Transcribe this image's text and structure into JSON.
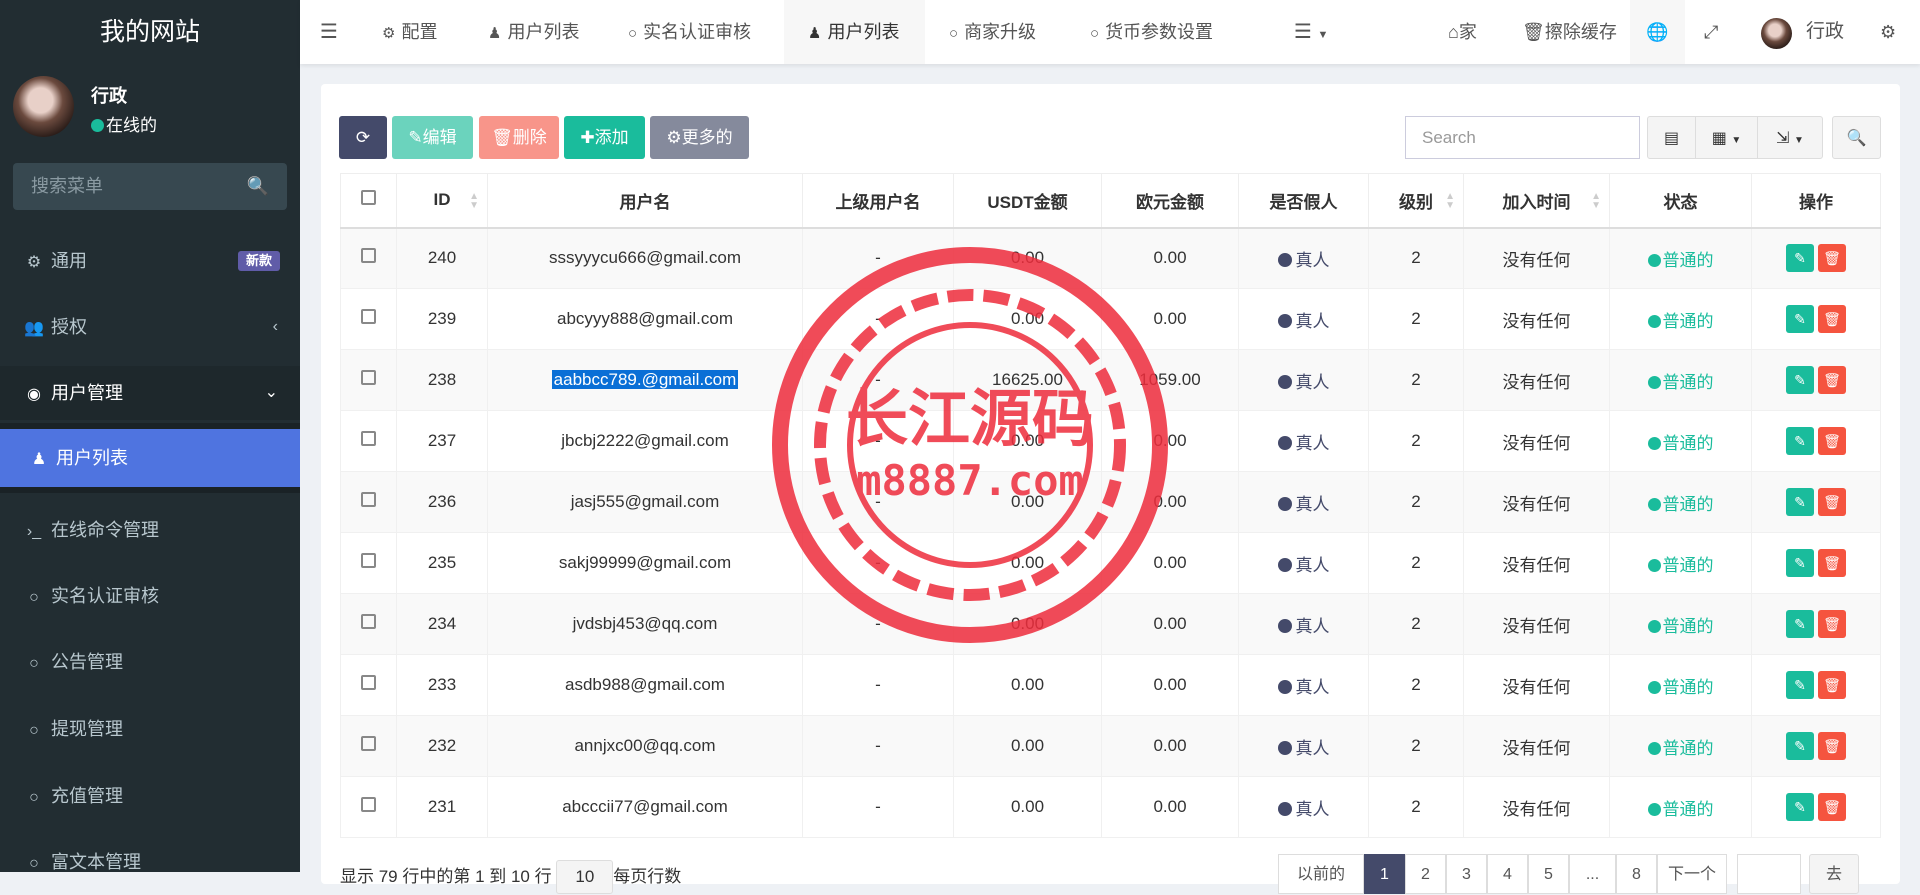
{
  "sidebar": {
    "logo": "我的网站",
    "user": {
      "name": "行政",
      "status": "在线的"
    },
    "search_placeholder": "搜索菜单",
    "items": [
      {
        "label": "通用",
        "badge": "新款"
      },
      {
        "label": "授权"
      },
      {
        "label": "用户管理"
      },
      {
        "label": "用户列表"
      },
      {
        "label": "在线命令管理"
      },
      {
        "label": "实名认证审核"
      },
      {
        "label": "公告管理"
      },
      {
        "label": "提现管理"
      },
      {
        "label": "充值管理"
      },
      {
        "label": "富文本管理"
      }
    ]
  },
  "topnav": {
    "tabs": [
      "配置",
      "用户列表",
      "实名认证审核",
      "用户列表",
      "商家升级",
      "货币参数设置"
    ],
    "home": "家",
    "clear_cache": "擦除缓存",
    "user": "行政"
  },
  "toolbar": {
    "edit": "编辑",
    "delete": "删除",
    "add": "添加",
    "more": "更多的",
    "search_placeholder": "Search"
  },
  "table": {
    "columns": [
      "ID",
      "用户名",
      "上级用户名",
      "USDT金额",
      "欧元金额",
      "是否假人",
      "级别",
      "加入时间",
      "状态",
      "操作"
    ],
    "rows": [
      {
        "id": "240",
        "username": "sssyyycu666@gmail.com",
        "parent": "-",
        "usdt": "0.00",
        "eur": "0.00",
        "fake": "真人",
        "level": "2",
        "joined": "没有任何",
        "status": "普通的"
      },
      {
        "id": "239",
        "username": "abcyyy888@gmail.com",
        "parent": "-",
        "usdt": "0.00",
        "eur": "0.00",
        "fake": "真人",
        "level": "2",
        "joined": "没有任何",
        "status": "普通的"
      },
      {
        "id": "238",
        "username": "aabbcc789.@gmail.com",
        "parent": "-",
        "usdt": "16625.00",
        "eur": "1059.00",
        "fake": "真人",
        "level": "2",
        "joined": "没有任何",
        "status": "普通的",
        "selected": true
      },
      {
        "id": "237",
        "username": "jbcbj2222@gmail.com",
        "parent": "-",
        "usdt": "0.00",
        "eur": "0.00",
        "fake": "真人",
        "level": "2",
        "joined": "没有任何",
        "status": "普通的"
      },
      {
        "id": "236",
        "username": "jasj555@gmail.com",
        "parent": "-",
        "usdt": "0.00",
        "eur": "0.00",
        "fake": "真人",
        "level": "2",
        "joined": "没有任何",
        "status": "普通的"
      },
      {
        "id": "235",
        "username": "sakj99999@gmail.com",
        "parent": "-",
        "usdt": "0.00",
        "eur": "0.00",
        "fake": "真人",
        "level": "2",
        "joined": "没有任何",
        "status": "普通的"
      },
      {
        "id": "234",
        "username": "jvdsbj453@qq.com",
        "parent": "-",
        "usdt": "0.00",
        "eur": "0.00",
        "fake": "真人",
        "level": "2",
        "joined": "没有任何",
        "status": "普通的"
      },
      {
        "id": "233",
        "username": "asdb988@gmail.com",
        "parent": "-",
        "usdt": "0.00",
        "eur": "0.00",
        "fake": "真人",
        "level": "2",
        "joined": "没有任何",
        "status": "普通的"
      },
      {
        "id": "232",
        "username": "annjxc00@qq.com",
        "parent": "-",
        "usdt": "0.00",
        "eur": "0.00",
        "fake": "真人",
        "level": "2",
        "joined": "没有任何",
        "status": "普通的"
      },
      {
        "id": "231",
        "username": "abcccii77@gmail.com",
        "parent": "-",
        "usdt": "0.00",
        "eur": "0.00",
        "fake": "真人",
        "level": "2",
        "joined": "没有任何",
        "status": "普通的"
      }
    ]
  },
  "footer": {
    "summary": "显示 79 行中的第 1 到 10 行",
    "page_size": "10",
    "page_size_label": "每页行数"
  },
  "pagination": {
    "prev": "以前的",
    "pages": [
      "1",
      "2",
      "3",
      "4",
      "5",
      "...",
      "8"
    ],
    "next": "下一个",
    "go": "去",
    "current": "1"
  },
  "watermark": {
    "line1": "长江源码",
    "line2": "m8887.com"
  },
  "colors": {
    "sidebar": "#222d32",
    "active": "#4f74e0",
    "teal": "#1abc9c",
    "red": "#f56954",
    "dark": "#444a6a"
  }
}
